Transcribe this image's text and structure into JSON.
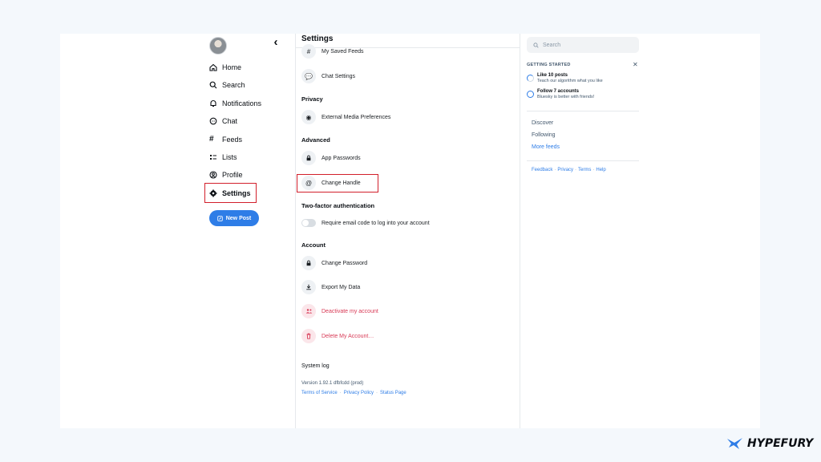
{
  "nav": {
    "collapse_icon": "chevron-left-icon",
    "items": [
      {
        "label": "Home",
        "icon": "home-icon"
      },
      {
        "label": "Search",
        "icon": "search-icon"
      },
      {
        "label": "Notifications",
        "icon": "bell-icon"
      },
      {
        "label": "Chat",
        "icon": "chat-icon"
      },
      {
        "label": "Feeds",
        "icon": "hash-icon"
      },
      {
        "label": "Lists",
        "icon": "list-icon"
      },
      {
        "label": "Profile",
        "icon": "user-icon"
      },
      {
        "label": "Settings",
        "icon": "gear-icon",
        "active": true
      }
    ],
    "new_post": "New Post"
  },
  "settings": {
    "title": "Settings",
    "rows": {
      "saved_feeds": "My Saved Feeds",
      "chat_settings": "Chat Settings",
      "external_media": "External Media Preferences",
      "app_passwords": "App Passwords",
      "change_handle": "Change Handle",
      "require_email": "Require email code to log into your account",
      "change_password": "Change Password",
      "export_data": "Export My Data",
      "deactivate": "Deactivate my account",
      "delete": "Delete My Account…"
    },
    "sections": {
      "privacy": "Privacy",
      "advanced": "Advanced",
      "two_factor": "Two-factor authentication",
      "account": "Account"
    },
    "system_log": "System log",
    "version": "Version 1.92.1 dfbfcdd (prod)",
    "links": [
      "Terms of Service",
      "Privacy Policy",
      "Status Page"
    ]
  },
  "sidebar_right": {
    "search_placeholder": "Search",
    "getting_started": {
      "title": "GETTING STARTED",
      "tasks": [
        {
          "title": "Like 10 posts",
          "subtitle": "Teach our algorithm what you like"
        },
        {
          "title": "Follow 7 accounts",
          "subtitle": "Bluesky is better with friends!"
        }
      ]
    },
    "feeds": [
      "Discover",
      "Following",
      "More feeds"
    ],
    "footer_links": [
      "Feedback",
      "Privacy",
      "Terms",
      "Help"
    ]
  },
  "brand": {
    "name": "HYPEFURY"
  },
  "colors": {
    "accent": "#2e7de7",
    "highlight": "#d21f2b",
    "danger": "#d83a56"
  }
}
